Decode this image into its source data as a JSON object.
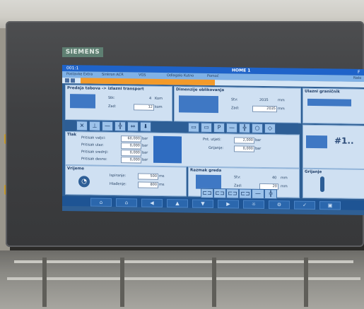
{
  "device": {
    "brand": "SIEMENS"
  },
  "screen": {
    "title_left": "001:1",
    "title_center": "HOME 1",
    "menu": [
      "Postavke Extra",
      "Sinkron ACR",
      "VGS",
      "Odlagalo Kutno",
      "Pomoć"
    ],
    "right_edge": [
      "F",
      "Nalo"
    ]
  },
  "panels": {
    "transport": {
      "title": "Predaja tabova -> izlazni transport",
      "stk_label": "Stk:",
      "stk_value": "4",
      "stk_unit": "Kom",
      "zad_label": "Zad:",
      "zad_value": "12",
      "zad_unit": "kom"
    },
    "dimensions": {
      "title": "Dimenzije oblikovanja",
      "stv_label": "Stv:",
      "stv_value": "2035",
      "stv_unit": "mm",
      "zad_label": "Zad:",
      "zad_value": "2035",
      "zad_unit": "mm"
    },
    "limiter": {
      "title": "Ulazni graničnik"
    },
    "pressure": {
      "title": "Tlak",
      "rows": [
        {
          "label": "Pritisak valjci:",
          "value": "60,000",
          "unit": "bar"
        },
        {
          "label": "Pritisak ulaz:",
          "value": "0,000",
          "unit": "bar"
        },
        {
          "label": "Pritisak srednji:",
          "value": "0,000",
          "unit": "bar"
        },
        {
          "label": "Pritisak desno:",
          "value": "0,000",
          "unit": "bar"
        }
      ],
      "pnt_label": "Pnt. utjeti:",
      "pnt_value": "2,000",
      "pnt_unit": "bar",
      "grijanje_label": "Grijanje:",
      "grijanje_value": "0,000",
      "grijanje_unit": "bar"
    },
    "counter": {
      "value": "#1.."
    },
    "timing": {
      "title": "Vrijeme",
      "rows": [
        {
          "label": "Ispiranje:",
          "value": "500",
          "unit": "ms"
        },
        {
          "label": "Hlađenje:",
          "value": "800",
          "unit": "ms"
        }
      ]
    },
    "spacing": {
      "title": "Razmak greda",
      "stv_label": "Stv:",
      "stv_value": "40",
      "stv_unit": "mm",
      "zad_label": "Zad:",
      "zad_value": "20",
      "zad_unit": "mm"
    },
    "heating": {
      "title": "Grijanje"
    }
  },
  "toolbar_symbols": [
    "✕",
    "⊥",
    "—",
    "╬",
    "⇔",
    "⬇"
  ],
  "toolbar_symbols_2": [
    "▭",
    "▭",
    "P",
    "—",
    "╬",
    "○",
    "◇"
  ],
  "toolbar_symbols_3": [
    "⊏⊐",
    "⊏⊐",
    "⊏⊐",
    "⊏⊐",
    "—",
    "╬"
  ],
  "nav_symbols": [
    "⌂",
    "⌂",
    "◀",
    "▲",
    "▼",
    "▶",
    "☼",
    "⚙",
    "✓",
    "▣"
  ],
  "colors": {
    "screen_bg": "#2f5f94",
    "title_bar": "#1f63c9",
    "alarm_bar": "#f39a2a",
    "panel": "#cfe0f2"
  }
}
